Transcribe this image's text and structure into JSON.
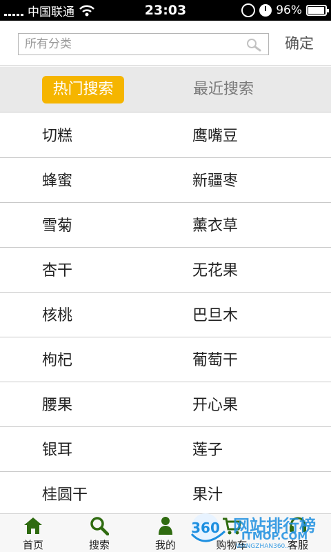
{
  "status_bar": {
    "carrier": "中国联通",
    "time": "23:03",
    "battery": "96%",
    "battery_level": 0.96
  },
  "search": {
    "placeholder": "所有分类",
    "confirm_label": "确定"
  },
  "tabs": {
    "hot": "热门搜索",
    "recent": "最近搜索"
  },
  "keywords": [
    [
      "切糕",
      "鹰嘴豆"
    ],
    [
      "蜂蜜",
      "新疆枣"
    ],
    [
      "雪菊",
      "薰衣草"
    ],
    [
      "杏干",
      "无花果"
    ],
    [
      "核桃",
      "巴旦木"
    ],
    [
      "枸杞",
      "葡萄干"
    ],
    [
      "腰果",
      "开心果"
    ],
    [
      "银耳",
      "莲子"
    ],
    [
      "桂圆干",
      "果汁"
    ]
  ],
  "nav": [
    {
      "label": "首页",
      "icon": "home-icon"
    },
    {
      "label": "搜索",
      "icon": "search-icon"
    },
    {
      "label": "我的",
      "icon": "user-icon"
    },
    {
      "label": "购物车",
      "icon": "cart-icon"
    },
    {
      "label": "客服",
      "icon": "service-icon"
    }
  ],
  "watermark": {
    "logo_text": "360",
    "line1": "网站排行榜",
    "line2": "ITMOP.COM",
    "line3": "WANGZHAN360..."
  },
  "colors": {
    "accent": "#f5b500",
    "nav_icon": "#2f6b10",
    "status_bar": "#000000",
    "tab_bar": "#e9e9e9"
  }
}
